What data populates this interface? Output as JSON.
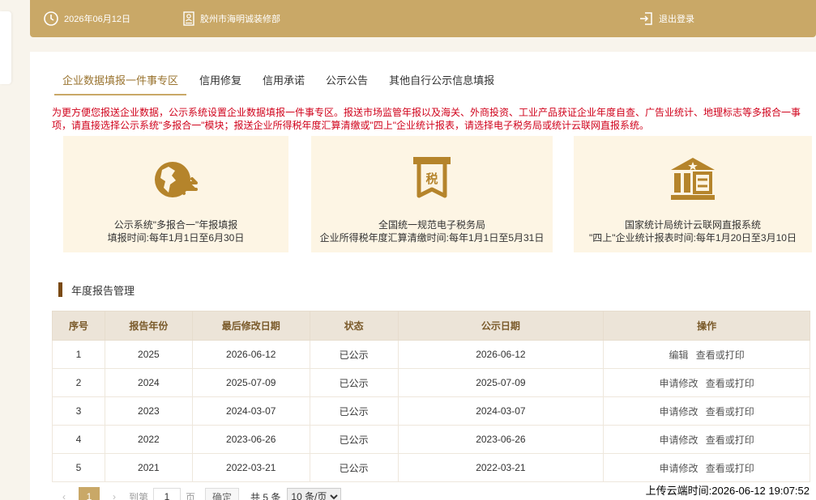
{
  "topbar": {
    "date": "2026年06月12日",
    "company": "胶州市海明诚装修部",
    "logout": "退出登录"
  },
  "tabs": [
    {
      "label": "企业数据填报一件事专区",
      "active": true
    },
    {
      "label": "信用修复"
    },
    {
      "label": "信用承诺"
    },
    {
      "label": "公示公告"
    },
    {
      "label": "其他自行公示信息填报"
    }
  ],
  "notice": "为更方便您报送企业数据，公示系统设置企业数据填报一件事专区。报送市场监管年报以及海关、外商投资、工业产品获证企业年度自查、广告业统计、地理标志等多报合一事项，请直接选择公示系统\"多报合一\"模块；报送企业所得税年度汇算清缴或\"四上\"企业统计报表，请选择电子税务局或统计云联网直报系统。",
  "cards": [
    {
      "icon": "multi-report-icon",
      "line1": "公示系统\"多报合一\"年报填报",
      "line2": "填报时间:每年1月1日至6月30日"
    },
    {
      "icon": "tax-icon",
      "icon_text": "税",
      "line1": "全国统一规范电子税务局",
      "line2": "企业所得税年度汇算清缴时间:每年1月1日至5月31日"
    },
    {
      "icon": "statistics-building-icon",
      "line1": "国家统计局统计云联网直报系统",
      "line2": "\"四上\"企业统计报表时间:每年1月20日至3月10日"
    }
  ],
  "section_title": "年度报告管理",
  "table": {
    "headers": [
      "序号",
      "报告年份",
      "最后修改日期",
      "状态",
      "公示日期",
      "操作"
    ],
    "rows": [
      {
        "no": "1",
        "year": "2025",
        "modified": "2026-06-12",
        "status": "已公示",
        "publish": "2026-06-12",
        "op1": "编辑",
        "op2": "查看或打印"
      },
      {
        "no": "2",
        "year": "2024",
        "modified": "2025-07-09",
        "status": "已公示",
        "publish": "2025-07-09",
        "op1": "申请修改",
        "op2": "查看或打印"
      },
      {
        "no": "3",
        "year": "2023",
        "modified": "2024-03-07",
        "status": "已公示",
        "publish": "2024-03-07",
        "op1": "申请修改",
        "op2": "查看或打印"
      },
      {
        "no": "4",
        "year": "2022",
        "modified": "2023-06-26",
        "status": "已公示",
        "publish": "2023-06-26",
        "op1": "申请修改",
        "op2": "查看或打印"
      },
      {
        "no": "5",
        "year": "2021",
        "modified": "2022-03-21",
        "status": "已公示",
        "publish": "2022-03-21",
        "op1": "申请修改",
        "op2": "查看或打印"
      }
    ]
  },
  "pager": {
    "prev": "‹",
    "current_page": "1",
    "next": "›",
    "goto_label": "到第",
    "goto_value": "1",
    "page_unit": "页",
    "confirm": "确定",
    "total": "共 5 条",
    "page_size": "10 条/页"
  },
  "upload_time": "上传云端时间:2026-06-12 19:07:52",
  "colors": {
    "accent": "#c9a867",
    "accent_dark": "#9a7430",
    "notice_red": "#d0021b",
    "card_bg": "#fdf5e4",
    "header_bg": "#ece4d8"
  }
}
